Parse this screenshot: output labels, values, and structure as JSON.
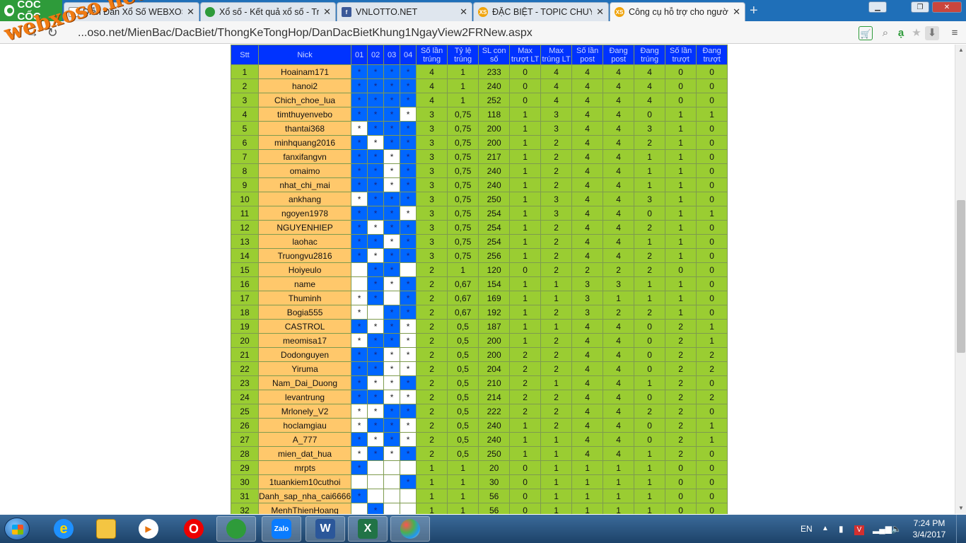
{
  "browser": {
    "brand": "CỐC CỐC",
    "tabs": [
      {
        "title": "Diễn Đàn Xổ Số WEBXOSO.NET - DIENDAN...",
        "favicon": "doc-icon",
        "active": false
      },
      {
        "title": "Xổ số - Kết quả xổ số - Trực tiếp",
        "favicon": "coccoc-icon",
        "active": false
      },
      {
        "title": "VNLOTTO.NET",
        "favicon": "facebook-icon",
        "active": false
      },
      {
        "title": "ĐẶC BIỆT - TOPIC CHUYÊN",
        "favicon": "xs-icon",
        "active": false
      },
      {
        "title": "Công cụ hỗ trợ cho người",
        "favicon": "xs-icon",
        "active": true
      }
    ],
    "url": "...oso.net/MienBac/DacBiet/ThongKeTongHop/DanDacBietKhung1NgayView2FRNew.aspx"
  },
  "watermark": "webxoso.net",
  "table": {
    "headers": [
      "Stt",
      "Nick",
      "01",
      "02",
      "03",
      "04",
      "Số lần trúng",
      "Tỷ lệ trúng",
      "SL con số",
      "Max trượt LT",
      "Max trúng LT",
      "Số lần post",
      "Đang post",
      "Đang trúng",
      "Số lần trượt",
      "Đang trượt"
    ],
    "rows": [
      {
        "stt": "1",
        "nick": "Hoainam171",
        "marks": [
          1,
          1,
          1,
          1
        ],
        "vals": [
          "4",
          "1",
          "233",
          "0",
          "4",
          "4",
          "4",
          "4",
          "0",
          "0"
        ]
      },
      {
        "stt": "2",
        "nick": "hanoi2",
        "marks": [
          1,
          1,
          1,
          1
        ],
        "vals": [
          "4",
          "1",
          "240",
          "0",
          "4",
          "4",
          "4",
          "4",
          "0",
          "0"
        ]
      },
      {
        "stt": "3",
        "nick": "Chich_choe_lua",
        "marks": [
          1,
          1,
          1,
          1
        ],
        "vals": [
          "4",
          "1",
          "252",
          "0",
          "4",
          "4",
          "4",
          "4",
          "0",
          "0"
        ]
      },
      {
        "stt": "4",
        "nick": "timthuyenvebo",
        "marks": [
          1,
          1,
          1,
          0
        ],
        "vals": [
          "3",
          "0,75",
          "118",
          "1",
          "3",
          "4",
          "4",
          "0",
          "1",
          "1"
        ]
      },
      {
        "stt": "5",
        "nick": "thantai368",
        "marks": [
          0,
          1,
          1,
          1
        ],
        "vals": [
          "3",
          "0,75",
          "200",
          "1",
          "3",
          "4",
          "4",
          "3",
          "1",
          "0"
        ]
      },
      {
        "stt": "6",
        "nick": "minhquang2016",
        "marks": [
          1,
          0,
          1,
          1
        ],
        "vals": [
          "3",
          "0,75",
          "200",
          "1",
          "2",
          "4",
          "4",
          "2",
          "1",
          "0"
        ]
      },
      {
        "stt": "7",
        "nick": "fanxifangvn",
        "marks": [
          1,
          1,
          0,
          1
        ],
        "vals": [
          "3",
          "0,75",
          "217",
          "1",
          "2",
          "4",
          "4",
          "1",
          "1",
          "0"
        ]
      },
      {
        "stt": "8",
        "nick": "omaimo",
        "marks": [
          1,
          1,
          0,
          1
        ],
        "vals": [
          "3",
          "0,75",
          "240",
          "1",
          "2",
          "4",
          "4",
          "1",
          "1",
          "0"
        ]
      },
      {
        "stt": "9",
        "nick": "nhat_chi_mai",
        "marks": [
          1,
          1,
          0,
          1
        ],
        "vals": [
          "3",
          "0,75",
          "240",
          "1",
          "2",
          "4",
          "4",
          "1",
          "1",
          "0"
        ]
      },
      {
        "stt": "10",
        "nick": "ankhang",
        "marks": [
          0,
          1,
          1,
          1
        ],
        "vals": [
          "3",
          "0,75",
          "250",
          "1",
          "3",
          "4",
          "4",
          "3",
          "1",
          "0"
        ]
      },
      {
        "stt": "11",
        "nick": "ngoyen1978",
        "marks": [
          1,
          1,
          1,
          0
        ],
        "vals": [
          "3",
          "0,75",
          "254",
          "1",
          "3",
          "4",
          "4",
          "0",
          "1",
          "1"
        ]
      },
      {
        "stt": "12",
        "nick": "NGUYENHIEP",
        "marks": [
          1,
          0,
          1,
          1
        ],
        "vals": [
          "3",
          "0,75",
          "254",
          "1",
          "2",
          "4",
          "4",
          "2",
          "1",
          "0"
        ]
      },
      {
        "stt": "13",
        "nick": "laohac",
        "marks": [
          1,
          1,
          0,
          1
        ],
        "vals": [
          "3",
          "0,75",
          "254",
          "1",
          "2",
          "4",
          "4",
          "1",
          "1",
          "0"
        ]
      },
      {
        "stt": "14",
        "nick": "Truongvu2816",
        "marks": [
          1,
          0,
          1,
          1
        ],
        "vals": [
          "3",
          "0,75",
          "256",
          "1",
          "2",
          "4",
          "4",
          "2",
          "1",
          "0"
        ]
      },
      {
        "stt": "15",
        "nick": "Hoiyeulo",
        "marks": [
          2,
          1,
          1,
          2
        ],
        "vals": [
          "2",
          "1",
          "120",
          "0",
          "2",
          "2",
          "2",
          "2",
          "0",
          "0"
        ]
      },
      {
        "stt": "16",
        "nick": "name",
        "marks": [
          2,
          1,
          0,
          1
        ],
        "vals": [
          "2",
          "0,67",
          "154",
          "1",
          "1",
          "3",
          "3",
          "1",
          "1",
          "0"
        ]
      },
      {
        "stt": "17",
        "nick": "Thuminh",
        "marks": [
          0,
          1,
          2,
          1
        ],
        "vals": [
          "2",
          "0,67",
          "169",
          "1",
          "1",
          "3",
          "1",
          "1",
          "1",
          "0"
        ]
      },
      {
        "stt": "18",
        "nick": "Bogia555",
        "marks": [
          0,
          2,
          1,
          1
        ],
        "vals": [
          "2",
          "0,67",
          "192",
          "1",
          "2",
          "3",
          "2",
          "2",
          "1",
          "0"
        ]
      },
      {
        "stt": "19",
        "nick": "CASTROL",
        "marks": [
          1,
          0,
          1,
          0
        ],
        "vals": [
          "2",
          "0,5",
          "187",
          "1",
          "1",
          "4",
          "4",
          "0",
          "2",
          "1"
        ]
      },
      {
        "stt": "20",
        "nick": "meomisa17",
        "marks": [
          0,
          1,
          1,
          0
        ],
        "vals": [
          "2",
          "0,5",
          "200",
          "1",
          "2",
          "4",
          "4",
          "0",
          "2",
          "1"
        ]
      },
      {
        "stt": "21",
        "nick": "Dodonguyen",
        "marks": [
          1,
          1,
          0,
          0
        ],
        "vals": [
          "2",
          "0,5",
          "200",
          "2",
          "2",
          "4",
          "4",
          "0",
          "2",
          "2"
        ]
      },
      {
        "stt": "22",
        "nick": "Yiruma",
        "marks": [
          1,
          1,
          0,
          0
        ],
        "vals": [
          "2",
          "0,5",
          "204",
          "2",
          "2",
          "4",
          "4",
          "0",
          "2",
          "2"
        ]
      },
      {
        "stt": "23",
        "nick": "Nam_Dai_Duong",
        "marks": [
          1,
          0,
          0,
          1
        ],
        "vals": [
          "2",
          "0,5",
          "210",
          "2",
          "1",
          "4",
          "4",
          "1",
          "2",
          "0"
        ]
      },
      {
        "stt": "24",
        "nick": "levantrung",
        "marks": [
          1,
          1,
          0,
          0
        ],
        "vals": [
          "2",
          "0,5",
          "214",
          "2",
          "2",
          "4",
          "4",
          "0",
          "2",
          "2"
        ]
      },
      {
        "stt": "25",
        "nick": "Mrlonely_V2",
        "marks": [
          0,
          0,
          1,
          1
        ],
        "vals": [
          "2",
          "0,5",
          "222",
          "2",
          "2",
          "4",
          "4",
          "2",
          "2",
          "0"
        ]
      },
      {
        "stt": "26",
        "nick": "hoclamgiau",
        "marks": [
          0,
          1,
          1,
          0
        ],
        "vals": [
          "2",
          "0,5",
          "240",
          "1",
          "2",
          "4",
          "4",
          "0",
          "2",
          "1"
        ]
      },
      {
        "stt": "27",
        "nick": "A_777",
        "marks": [
          1,
          0,
          1,
          0
        ],
        "vals": [
          "2",
          "0,5",
          "240",
          "1",
          "1",
          "4",
          "4",
          "0",
          "2",
          "1"
        ]
      },
      {
        "stt": "28",
        "nick": "mien_dat_hua",
        "marks": [
          0,
          1,
          0,
          1
        ],
        "vals": [
          "2",
          "0,5",
          "250",
          "1",
          "1",
          "4",
          "4",
          "1",
          "2",
          "0"
        ]
      },
      {
        "stt": "29",
        "nick": "mrpts",
        "marks": [
          1,
          2,
          2,
          2
        ],
        "vals": [
          "1",
          "1",
          "20",
          "0",
          "1",
          "1",
          "1",
          "1",
          "0",
          "0"
        ]
      },
      {
        "stt": "30",
        "nick": "1tuankiem10cuthoi",
        "marks": [
          2,
          2,
          2,
          1
        ],
        "vals": [
          "1",
          "1",
          "30",
          "0",
          "1",
          "1",
          "1",
          "1",
          "0",
          "0"
        ]
      },
      {
        "stt": "31",
        "nick": "Danh_sap_nha_cai6666",
        "marks": [
          1,
          2,
          2,
          2
        ],
        "vals": [
          "1",
          "1",
          "56",
          "0",
          "1",
          "1",
          "1",
          "1",
          "0",
          "0"
        ]
      },
      {
        "stt": "32",
        "nick": "MenhThienHoang",
        "marks": [
          2,
          1,
          2,
          2
        ],
        "vals": [
          "1",
          "1",
          "56",
          "0",
          "1",
          "1",
          "1",
          "1",
          "0",
          "0"
        ]
      }
    ]
  },
  "taskbar": {
    "language": "EN",
    "time": "7:24 PM",
    "date": "3/4/2017",
    "apps": [
      {
        "name": "internet-explorer",
        "label": "e"
      },
      {
        "name": "file-explorer",
        "label": ""
      },
      {
        "name": "media-player",
        "label": "▶"
      },
      {
        "name": "opera",
        "label": "O"
      },
      {
        "name": "coccoc",
        "label": ""
      },
      {
        "name": "zalo",
        "label": "Zalo"
      },
      {
        "name": "word",
        "label": "W"
      },
      {
        "name": "excel",
        "label": "X"
      },
      {
        "name": "paint",
        "label": ""
      }
    ]
  },
  "colors": {
    "tabbar": "#1f6fb8",
    "header": "#0033ff",
    "mark_on": "#0066ff",
    "num_cell": "#9acd32",
    "nick_cell": "#ffc86b"
  }
}
